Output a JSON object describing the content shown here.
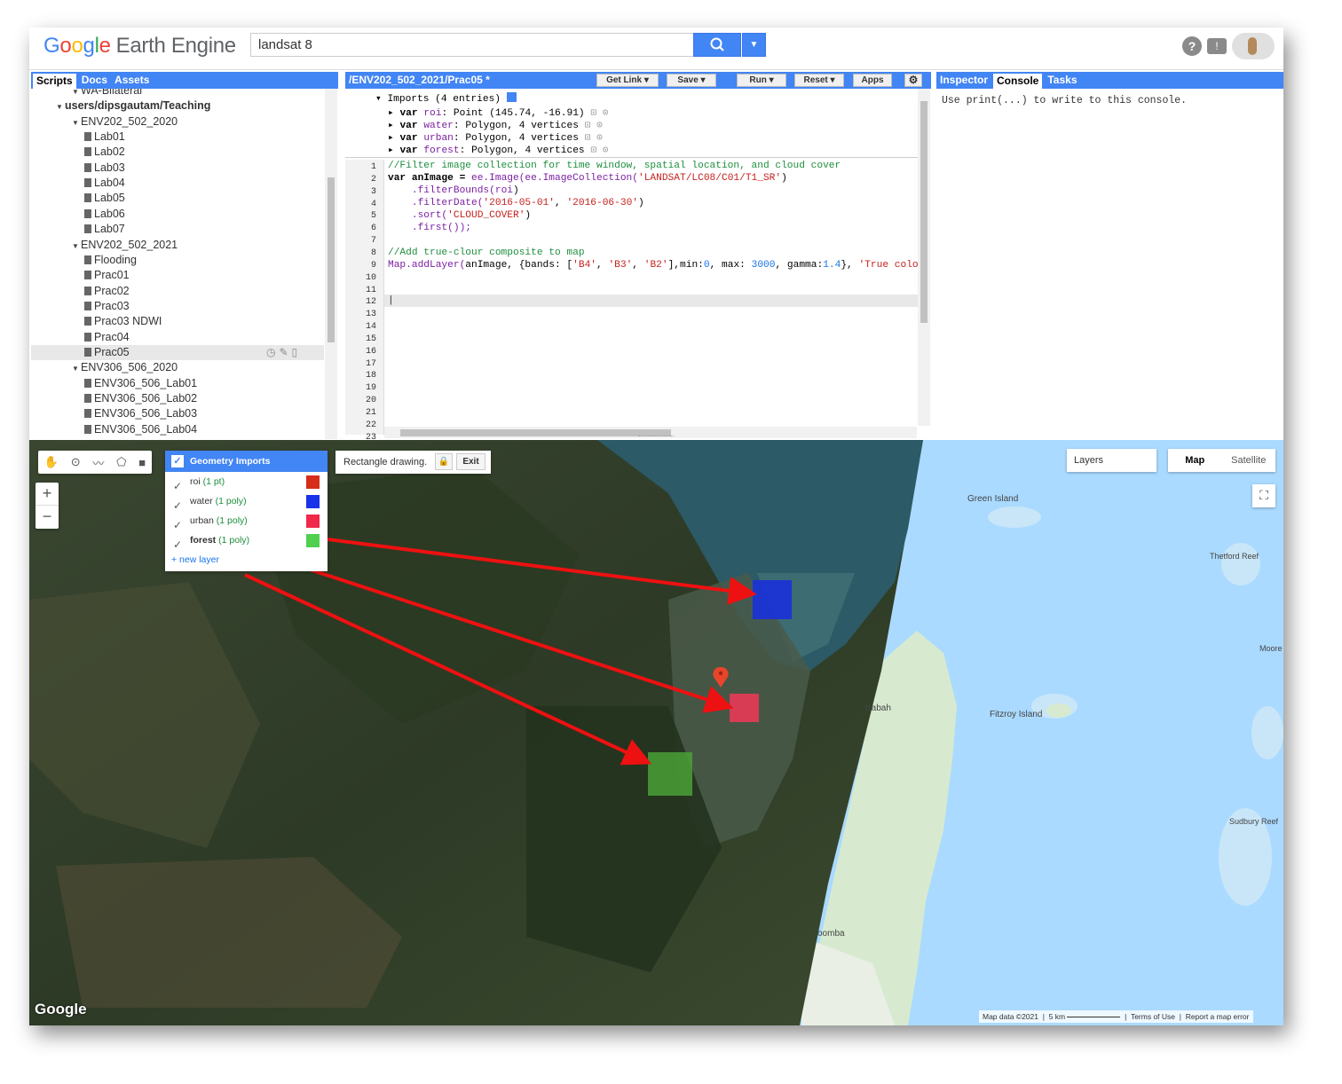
{
  "topbar": {
    "logo_google": [
      "G",
      "o",
      "o",
      "g",
      "l",
      "e"
    ],
    "logo_product": "Earth Engine",
    "search_value": "landsat 8"
  },
  "left_panel": {
    "tabs": [
      "Scripts",
      "Docs",
      "Assets"
    ],
    "active_tab": "Scripts",
    "tree": [
      {
        "label": "WA-Bilateral",
        "kind": "folder",
        "depth": 2,
        "cut": true
      },
      {
        "label": "users/dipsgautam/Teaching",
        "kind": "repo",
        "depth": 1
      },
      {
        "label": "ENV202_502_2020",
        "kind": "folder",
        "depth": 2
      },
      {
        "label": "Lab01",
        "kind": "file",
        "depth": 3
      },
      {
        "label": "Lab02",
        "kind": "file",
        "depth": 3
      },
      {
        "label": "Lab03",
        "kind": "file",
        "depth": 3
      },
      {
        "label": "Lab04",
        "kind": "file",
        "depth": 3
      },
      {
        "label": "Lab05",
        "kind": "file",
        "depth": 3
      },
      {
        "label": "Lab06",
        "kind": "file",
        "depth": 3
      },
      {
        "label": "Lab07",
        "kind": "file",
        "depth": 3
      },
      {
        "label": "ENV202_502_2021",
        "kind": "folder",
        "depth": 2
      },
      {
        "label": "Flooding",
        "kind": "file",
        "depth": 3
      },
      {
        "label": "Prac01",
        "kind": "file",
        "depth": 3
      },
      {
        "label": "Prac02",
        "kind": "file",
        "depth": 3
      },
      {
        "label": "Prac03",
        "kind": "file",
        "depth": 3
      },
      {
        "label": "Prac03 NDWI",
        "kind": "file",
        "depth": 3
      },
      {
        "label": "Prac04",
        "kind": "file",
        "depth": 3
      },
      {
        "label": "Prac05",
        "kind": "file",
        "depth": 3,
        "selected": true
      },
      {
        "label": "ENV306_506_2020",
        "kind": "folder",
        "depth": 2
      },
      {
        "label": "ENV306_506_Lab01",
        "kind": "file",
        "depth": 3
      },
      {
        "label": "ENV306_506_Lab02",
        "kind": "file",
        "depth": 3
      },
      {
        "label": "ENV306_506_Lab03",
        "kind": "file",
        "depth": 3
      },
      {
        "label": "ENV306_506_Lab04",
        "kind": "file",
        "depth": 3
      }
    ]
  },
  "editor": {
    "title": "/ENV202_502_2021/Prac05 *",
    "buttons": [
      "Get Link",
      "Save",
      "Run",
      "Reset",
      "Apps"
    ],
    "imports_header": "Imports (4 entries)",
    "imports": [
      {
        "name": "roi",
        "desc": "Point (145.74, -16.91)"
      },
      {
        "name": "water",
        "desc": "Polygon, 4 vertices"
      },
      {
        "name": "urban",
        "desc": "Polygon, 4 vertices"
      },
      {
        "name": "forest",
        "desc": "Polygon, 4 vertices"
      }
    ],
    "line_numbers": [
      "1",
      "2",
      "3",
      "4",
      "5",
      "6",
      "7",
      "8",
      "9",
      "10",
      "11",
      "12",
      "13",
      "14",
      "15",
      "16",
      "17",
      "18",
      "19",
      "20",
      "21",
      "22",
      "23"
    ],
    "code": {
      "l1": "//Filter image collection for time window, spatial location, and cloud cover",
      "l2a": "var anImage = ",
      "l2b": "ee.Image(ee.ImageCollection(",
      "l2c": "'LANDSAT/LC08/C01/T1_SR'",
      "l2d": ")",
      "l3a": "    .filterBounds(",
      "l3b": "roi",
      "l3c": ")",
      "l4a": "    .filterDate(",
      "l4b": "'2016-05-01'",
      "l4c": ", ",
      "l4d": "'2016-06-30'",
      "l4e": ")",
      "l5a": "    .sort(",
      "l5b": "'CLOUD_COVER'",
      "l5c": ")",
      "l6": "    .first());",
      "l8": "//Add true-clour composite to map",
      "l9a": "Map.addLayer(",
      "l9b": "anImage, {bands: [",
      "l9c": "'B4'",
      "l9d": ", ",
      "l9e": "'B3'",
      "l9f": ", ",
      "l9g": "'B2'",
      "l9h": "],min:",
      "l9i": "0",
      "l9j": ", max: ",
      "l9k": "3000",
      "l9l": ", gamma:",
      "l9m": "1.4",
      "l9n": "}, ",
      "l9o": "'True colour"
    }
  },
  "right_panel": {
    "tabs": [
      "Inspector",
      "Console",
      "Tasks"
    ],
    "active_tab": "Console",
    "console_text": "Use print(...) to write to this console."
  },
  "map": {
    "geometry_imports": {
      "title": "Geometry Imports",
      "layers": [
        {
          "name": "roi",
          "count": "(1 pt)",
          "color": "#d62c1a"
        },
        {
          "name": "water",
          "count": "(1 poly)",
          "color": "#1a32e8"
        },
        {
          "name": "urban",
          "count": "(1 poly)",
          "color": "#f0284a"
        },
        {
          "name": "forest",
          "count": "(1 poly)",
          "color": "#4fd04f"
        }
      ],
      "new_layer": "+ new layer"
    },
    "rect_drawing": "Rectangle drawing.",
    "rect_exit": "Exit",
    "layers_label": "Layers",
    "map_types": [
      "Map",
      "Satellite"
    ],
    "active_map_type": "Map",
    "place_labels": [
      "Green Island",
      "Thetford Reef",
      "Moore",
      "rrabah",
      "Fitzroy Island",
      "Sudbury Reef",
      "oomba"
    ],
    "google_logo": "Google",
    "attribution": {
      "data": "Map data ©2021",
      "scale": "5 km",
      "terms": "Terms of Use",
      "report": "Report a map error"
    },
    "zoom_in": "+",
    "zoom_out": "−"
  },
  "colors": {
    "accent": "#4285f4",
    "water_sea": "#aadaff",
    "land": "#e8f0e0"
  }
}
